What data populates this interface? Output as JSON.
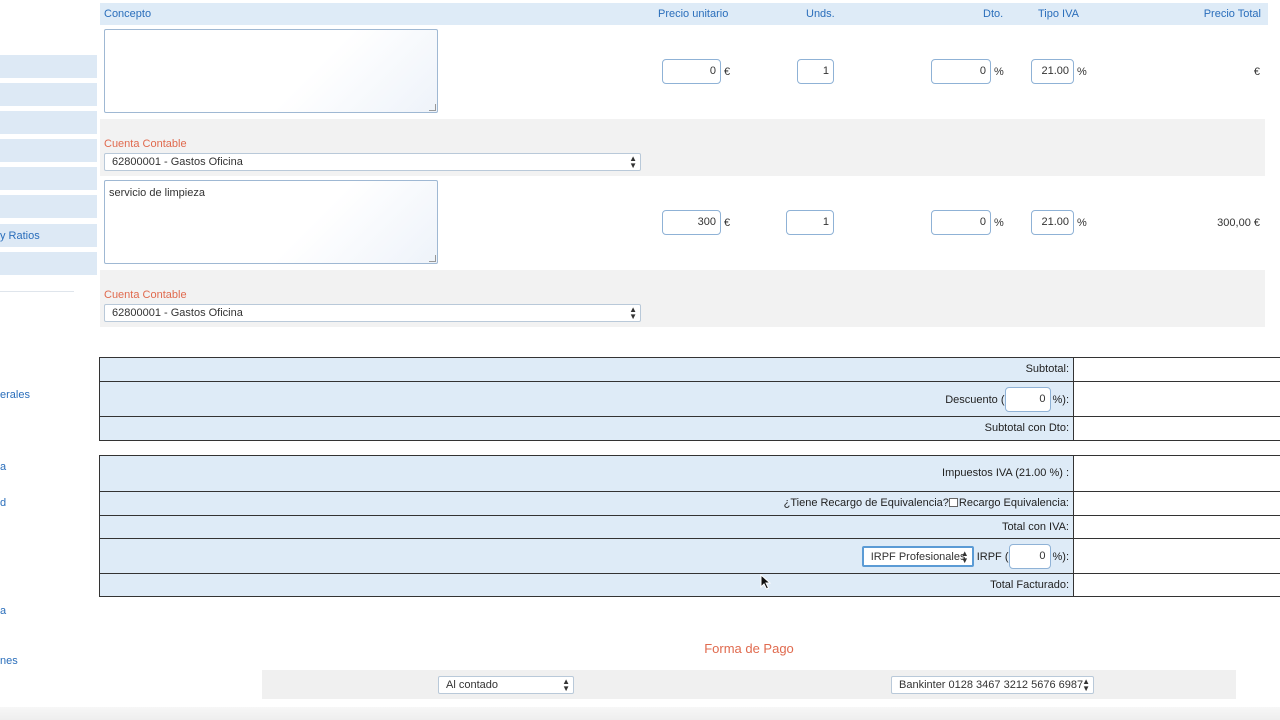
{
  "sidebar": {
    "links": [
      "y Ratios",
      "erales",
      "a",
      "d",
      "a",
      "nes"
    ]
  },
  "header": {
    "concepto": "Concepto",
    "precio_unitario": "Precio unitario",
    "unds": "Unds.",
    "dto": "Dto.",
    "tipo_iva": "Tipo IVA",
    "precio_total": "Precio Total"
  },
  "lines": [
    {
      "concepto": "",
      "precio": "0",
      "precio_unit": "€",
      "unds": "1",
      "dto": "0",
      "dto_unit": "%",
      "iva": "21.00",
      "iva_unit": "%",
      "total": "€",
      "cuenta_label": "Cuenta Contable",
      "cuenta_value": "62800001 - Gastos Oficina"
    },
    {
      "concepto": "servicio de limpieza",
      "precio": "300",
      "precio_unit": "€",
      "unds": "1",
      "dto": "0",
      "dto_unit": "%",
      "iva": "21.00",
      "iva_unit": "%",
      "total": "300,00 €",
      "cuenta_label": "Cuenta Contable",
      "cuenta_value": "62800001 - Gastos Oficina"
    }
  ],
  "summary": {
    "subtotal": "Subtotal:",
    "descuento_pre": "Descuento (",
    "descuento_value": "0",
    "descuento_post": "%):",
    "subtotal_dto": "Subtotal con Dto:"
  },
  "taxes": {
    "impuestos": "Impuestos IVA (21.00 %) :",
    "recargo_question": "¿Tiene Recargo de Equivalencia?",
    "recargo_label": "Recargo Equivalencia:",
    "total_iva": "Total con IVA:",
    "irpf_select": "IRPF Profesionales",
    "irpf_pre": "IRPF (",
    "irpf_value": "0",
    "irpf_post": "%):",
    "total_facturado": "Total Facturado:"
  },
  "payment": {
    "title": "Forma de Pago",
    "method": "Al contado",
    "bank": "Bankinter 0128 3467 3212 5676 6987"
  },
  "colors": {
    "link": "#2a6ebb",
    "accent": "#e06a4e",
    "row_bg": "#deebf7"
  }
}
